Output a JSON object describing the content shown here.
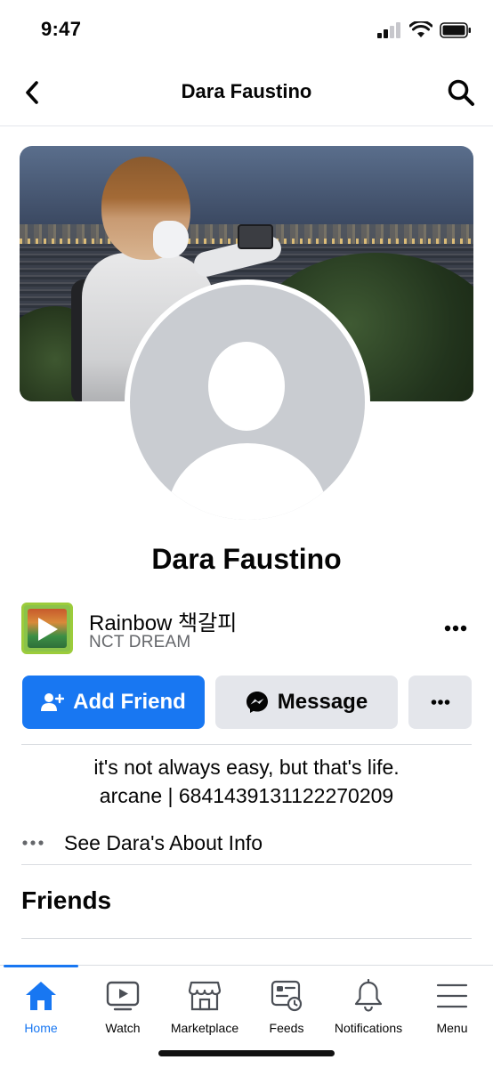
{
  "status_bar": {
    "time": "9:47"
  },
  "nav": {
    "title": "Dara Faustino"
  },
  "profile": {
    "name": "Dara Faustino",
    "song": {
      "title": "Rainbow 책갈피",
      "artist": "NCT DREAM"
    },
    "bio_line1": "it's not always easy, but that's life.",
    "bio_line2": "arcane | 6841439131122270209"
  },
  "actions": {
    "add_friend": "Add Friend",
    "message": "Message"
  },
  "about": {
    "label": "See Dara's About Info"
  },
  "friends": {
    "heading": "Friends"
  },
  "tabs": [
    {
      "label": "Home",
      "icon": "home-icon",
      "active": true
    },
    {
      "label": "Watch",
      "icon": "watch-icon",
      "active": false
    },
    {
      "label": "Marketplace",
      "icon": "marketplace-icon",
      "active": false
    },
    {
      "label": "Feeds",
      "icon": "feeds-icon",
      "active": false
    },
    {
      "label": "Notifications",
      "icon": "bell-icon",
      "active": false
    },
    {
      "label": "Menu",
      "icon": "menu-icon",
      "active": false
    }
  ],
  "colors": {
    "accent": "#1877f2",
    "button_gray": "#e4e6eb",
    "secondary_text": "#65676b"
  }
}
